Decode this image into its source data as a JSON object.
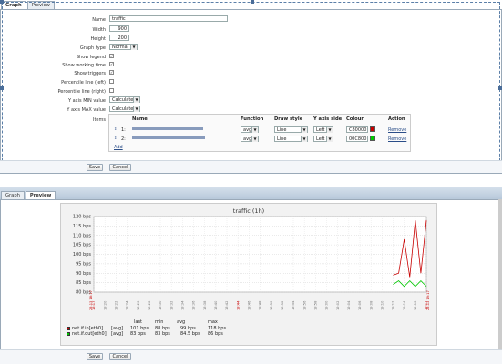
{
  "top": {
    "tabs": [
      {
        "label": "Graph",
        "active": true
      },
      {
        "label": "Preview",
        "active": false
      }
    ],
    "form": {
      "name_label": "Name",
      "name_value": "traffic",
      "width_label": "Width",
      "width_value": "900",
      "height_label": "Height",
      "height_value": "200",
      "graph_type_label": "Graph type",
      "graph_type_value": "Normal",
      "show_legend_label": "Show legend",
      "show_legend": true,
      "show_working_time_label": "Show working time",
      "show_working_time": true,
      "show_triggers_label": "Show triggers",
      "show_triggers": true,
      "percentile_left_label": "Percentile line (left)",
      "percentile_left": false,
      "percentile_right_label": "Percentile line (right)",
      "percentile_right": false,
      "ymin_label": "Y axis MIN value",
      "ymin_value": "Calculated",
      "ymax_label": "Y axis MAX value",
      "ymax_value": "Calculated",
      "items_label": "Items"
    },
    "items_table": {
      "headers": [
        "Name",
        "Function",
        "Draw style",
        "Y axis side",
        "Colour",
        "Action"
      ],
      "rows": [
        {
          "order": "1:",
          "name": "(text unreadable)",
          "function": "avg",
          "draw_style": "Line",
          "y_axis_side": "Left",
          "colour": "C80000",
          "swatch": "#c80000",
          "action": "Remove"
        },
        {
          "order": "2:",
          "name": "(text unreadable)",
          "function": "avg",
          "draw_style": "Line",
          "y_axis_side": "Left",
          "colour": "00C800",
          "swatch": "#00c800",
          "action": "Remove"
        }
      ],
      "add_label": "Add"
    },
    "save_label": "Save",
    "cancel_label": "Cancel"
  },
  "bottom": {
    "tabs": [
      {
        "label": "Graph",
        "active": false
      },
      {
        "label": "Preview",
        "active": true
      }
    ],
    "save_label": "Save",
    "cancel_label": "Cancel"
  },
  "chart_data": {
    "type": "line",
    "title": "traffic (1h)",
    "ylim": [
      80,
      120
    ],
    "yticks": [
      "120 bps",
      "115 bps",
      "110 bps",
      "105 bps",
      "100 bps",
      "95 bps",
      "90 bps",
      "85 bps",
      "80 bps"
    ],
    "xticks": [
      "18:17",
      "18:20",
      "18:22",
      "18:24",
      "18:26",
      "18:28",
      "18:30",
      "18:32",
      "18:34",
      "18:36",
      "18:38",
      "18:40",
      "18:42",
      "18:44",
      "18:46",
      "18:48",
      "18:50",
      "18:52",
      "18:54",
      "18:56",
      "18:58",
      "19:00",
      "19:02",
      "19:04",
      "19:06",
      "19:08",
      "19:10",
      "19:12",
      "19:14",
      "19:16",
      "19:17"
    ],
    "x_start_label": "25.13 18:17",
    "x_end_label": "25.13 19:17",
    "grid": true,
    "legend": {
      "headers": [
        "",
        "",
        "last",
        "min",
        "avg",
        "max"
      ],
      "rows": [
        {
          "name": "net.if.in[eth0]",
          "func": "[avg]",
          "last": "101 bps",
          "min": "88 bps",
          "avg": "99 bps",
          "max": "118 bps",
          "color": "#c80000"
        },
        {
          "name": "net.if.out[eth0]",
          "func": "[avg]",
          "last": "83 bps",
          "min": "83 bps",
          "avg": "84.5 bps",
          "max": "86 bps",
          "color": "#00c800"
        }
      ]
    },
    "series": [
      {
        "name": "net.if.in[eth0]",
        "color": "#c80000",
        "x": [
          54.0,
          55.0,
          56.0,
          57.0,
          58.0,
          59.0,
          60.0
        ],
        "values": [
          89,
          90,
          108,
          88,
          118,
          90,
          118
        ]
      },
      {
        "name": "net.if.out[eth0]",
        "color": "#00c800",
        "x": [
          54.0,
          55.0,
          56.0,
          57.0,
          58.0,
          59.0,
          60.0
        ],
        "values": [
          84,
          86,
          83,
          86,
          83,
          86,
          83
        ]
      }
    ]
  }
}
